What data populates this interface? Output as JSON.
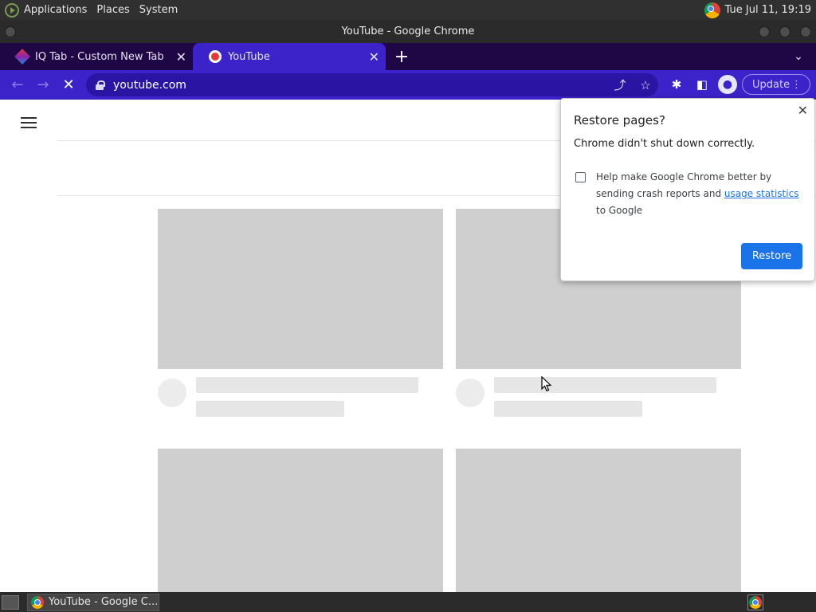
{
  "top_panel": {
    "menu": [
      "Applications",
      "Places",
      "System"
    ],
    "clock": "Tue Jul 11, 19:19"
  },
  "window": {
    "title": "YouTube - Google Chrome"
  },
  "tabs": [
    {
      "title": "IQ Tab - Custom New Tab",
      "favicon": "iq-tab-icon",
      "active": false
    },
    {
      "title": "YouTube",
      "favicon": "youtube-icon",
      "active": true
    }
  ],
  "toolbar": {
    "url": "youtube.com",
    "update_label": "Update"
  },
  "restore_dialog": {
    "title": "Restore pages?",
    "message": "Chrome didn't shut down correctly.",
    "checkbox_text_before": "Help make Google Chrome better by sending crash reports and ",
    "checkbox_link": "usage statistics",
    "checkbox_text_after": " to Google",
    "checkbox_checked": false,
    "button_label": "Restore"
  },
  "taskbar": {
    "window_label": "YouTube - Google C..."
  },
  "colors": {
    "chrome_frame": "#3b22c9",
    "tab_strip": "#1f0645",
    "restore_button": "#1a73e8",
    "skeleton": "#cfcfcf"
  }
}
